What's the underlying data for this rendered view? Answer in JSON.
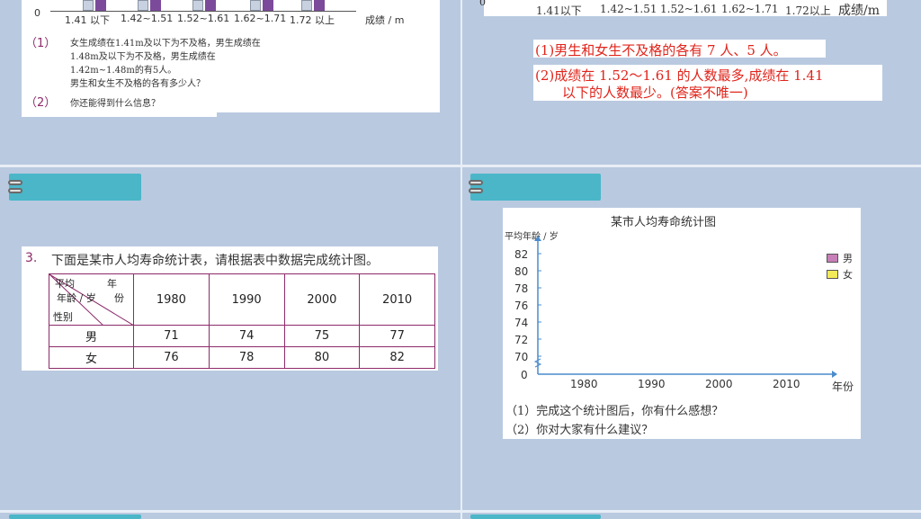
{
  "top_left": {
    "zero": "0",
    "ticks": [
      "1.41 以下",
      "1.42~1.51",
      "1.52~1.61",
      "1.62~1.71",
      "1.72 以上"
    ],
    "axis_unit": "成绩 / m",
    "q1_num": "（1）",
    "q1_lines": [
      "女生成绩在1.41m及以下为不及格，男生成绩在",
      "1.48m及以下为不及格，男生成绩在",
      "1.42m~1.48m的有5人。",
      "男生和女生不及格的各有多少人？"
    ],
    "q2_num": "（2）",
    "q2_text": "你还能得到什么信息？"
  },
  "top_right": {
    "zero": "0",
    "ticks": [
      "1.41以下",
      "1.42~1.51",
      "1.52~1.61",
      "1.62~1.71",
      "1.72以上"
    ],
    "axis_unit": "成绩/m",
    "answer1": "(1)男生和女生不及格的各有 7 人、5 人。",
    "answer2_l1": "(2)成绩在 1.52～1.61 的人数最多,成绩在 1.41",
    "answer2_l2": "以下的人数最少。(答案不唯一)"
  },
  "problem3": {
    "num": "3.",
    "text": "下面是某市人均寿命统计表，请根据表中数据完成统计图。",
    "header_year": "年",
    "header_avg": "平均",
    "header_age": "年龄 / 岁",
    "header_share": "份",
    "header_gender": "性别",
    "years": [
      "1980",
      "1990",
      "2000",
      "2010"
    ],
    "rows": [
      {
        "label": "男",
        "values": [
          "71",
          "74",
          "75",
          "77"
        ]
      },
      {
        "label": "女",
        "values": [
          "76",
          "78",
          "80",
          "82"
        ]
      }
    ]
  },
  "chart_panel": {
    "title": "某市人均寿命统计图",
    "ylabel": "平均年龄 / 岁",
    "yticks": [
      "82",
      "80",
      "78",
      "76",
      "74",
      "72",
      "70",
      "0"
    ],
    "xticks": [
      "1980",
      "1990",
      "2000",
      "2010"
    ],
    "xlabel": "年份",
    "legend": [
      {
        "label": "男",
        "color": "#c77fb8"
      },
      {
        "label": "女",
        "color": "#f3ea5a"
      }
    ],
    "q1": "（1）完成这个统计图后，你有什么感想？",
    "q2": "（2）你对大家有什么建议？"
  }
}
